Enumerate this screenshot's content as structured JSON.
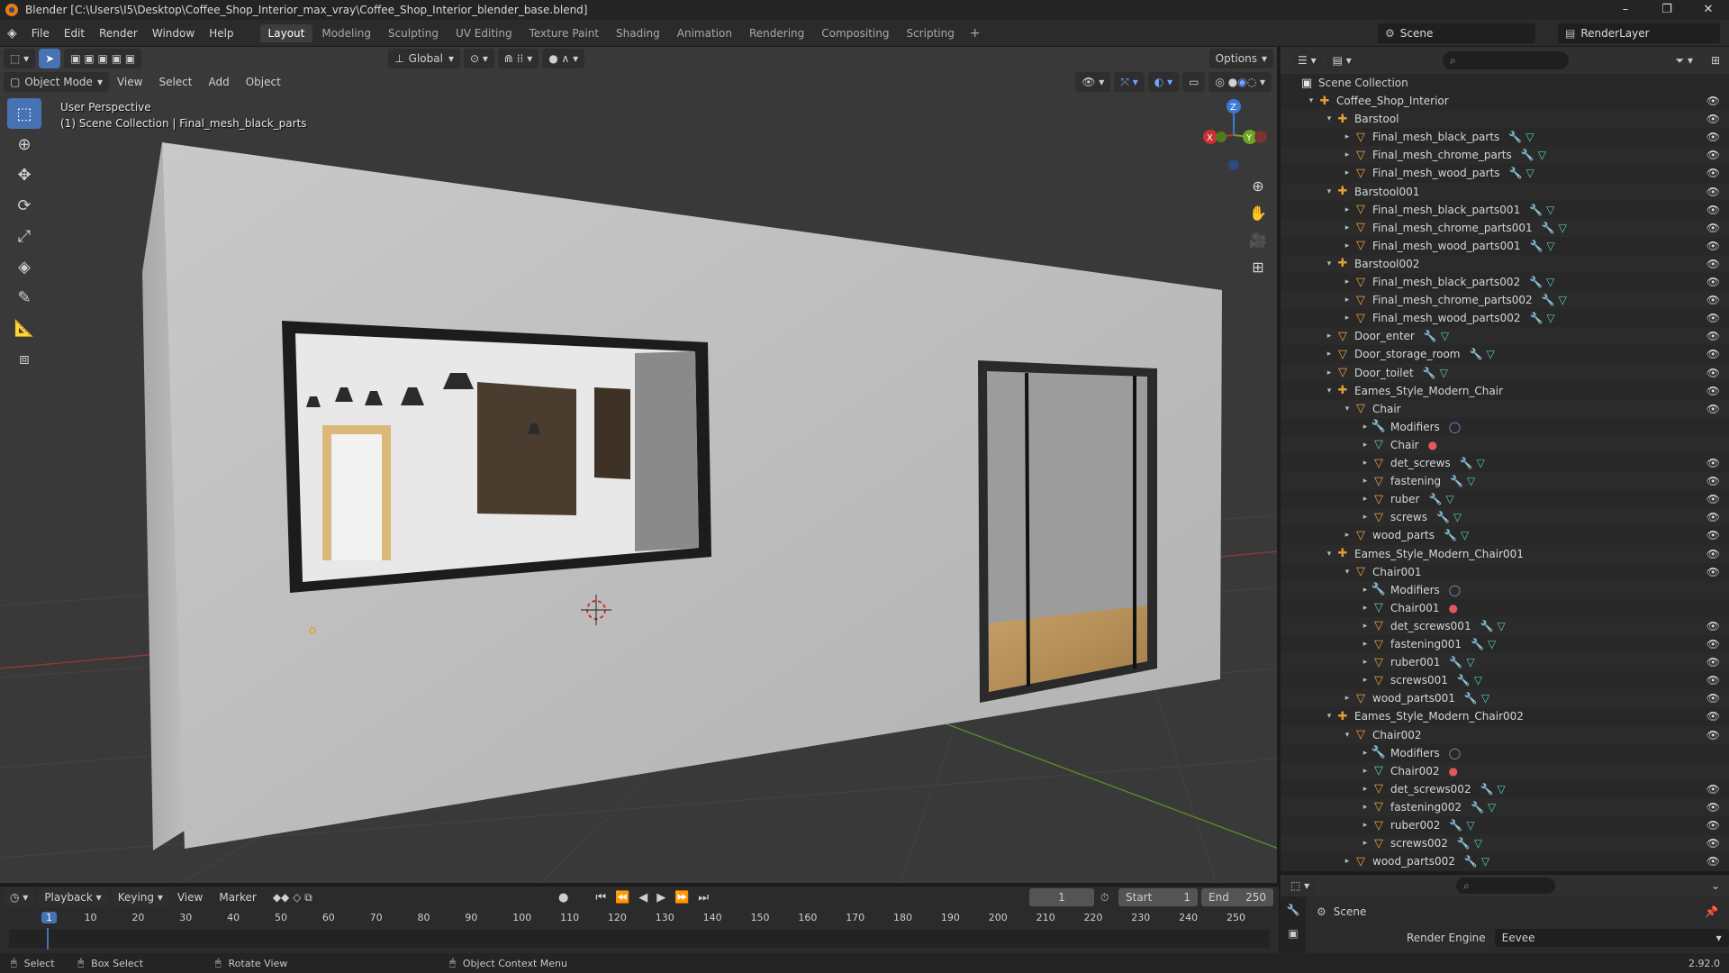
{
  "window": {
    "title": "Blender [C:\\Users\\I5\\Desktop\\Coffee_Shop_Interior_max_vray\\Coffee_Shop_Interior_blender_base.blend]",
    "controls": [
      "–",
      "❐",
      "✕"
    ]
  },
  "menubar": {
    "menus": [
      "File",
      "Edit",
      "Render",
      "Window",
      "Help"
    ],
    "workspaces": [
      "Layout",
      "Modeling",
      "Sculpting",
      "UV Editing",
      "Texture Paint",
      "Shading",
      "Animation",
      "Rendering",
      "Compositing",
      "Scripting"
    ],
    "active_workspace": "Layout",
    "scene": "Scene",
    "view_layer": "RenderLayer"
  },
  "viewport": {
    "mode": "Object Mode",
    "menus": [
      "View",
      "Select",
      "Add",
      "Object"
    ],
    "transform_orientation": "Global",
    "options_label": "Options",
    "info_line1": "User Perspective",
    "info_line2": "(1) Scene Collection | Final_mesh_black_parts",
    "gizmo": {
      "z": "Z",
      "y": "Y",
      "x": "X"
    }
  },
  "outliner": {
    "root": "Scene Collection",
    "rows": [
      {
        "indent": 1,
        "arrow": "▾",
        "icon": "empty",
        "label": "Coffee_Shop_Interior",
        "tags": [],
        "eye": true
      },
      {
        "indent": 2,
        "arrow": "▾",
        "icon": "empty",
        "label": "Barstool",
        "tags": [],
        "eye": true
      },
      {
        "indent": 3,
        "arrow": "▸",
        "icon": "mesh",
        "label": "Final_mesh_black_parts",
        "tags": [
          "w",
          "t"
        ],
        "eye": true
      },
      {
        "indent": 3,
        "arrow": "▸",
        "icon": "mesh",
        "label": "Final_mesh_chrome_parts",
        "tags": [
          "w",
          "t"
        ],
        "eye": true
      },
      {
        "indent": 3,
        "arrow": "▸",
        "icon": "mesh",
        "label": "Final_mesh_wood_parts",
        "tags": [
          "w",
          "t"
        ],
        "eye": true
      },
      {
        "indent": 2,
        "arrow": "▾",
        "icon": "empty",
        "label": "Barstool001",
        "tags": [],
        "eye": true
      },
      {
        "indent": 3,
        "arrow": "▸",
        "icon": "mesh",
        "label": "Final_mesh_black_parts001",
        "tags": [
          "w",
          "t"
        ],
        "eye": true
      },
      {
        "indent": 3,
        "arrow": "▸",
        "icon": "mesh",
        "label": "Final_mesh_chrome_parts001",
        "tags": [
          "w",
          "t"
        ],
        "eye": true
      },
      {
        "indent": 3,
        "arrow": "▸",
        "icon": "mesh",
        "label": "Final_mesh_wood_parts001",
        "tags": [
          "w",
          "t"
        ],
        "eye": true
      },
      {
        "indent": 2,
        "arrow": "▾",
        "icon": "empty",
        "label": "Barstool002",
        "tags": [],
        "eye": true
      },
      {
        "indent": 3,
        "arrow": "▸",
        "icon": "mesh",
        "label": "Final_mesh_black_parts002",
        "tags": [
          "w",
          "t"
        ],
        "eye": true
      },
      {
        "indent": 3,
        "arrow": "▸",
        "icon": "mesh",
        "label": "Final_mesh_chrome_parts002",
        "tags": [
          "w",
          "t"
        ],
        "eye": true
      },
      {
        "indent": 3,
        "arrow": "▸",
        "icon": "mesh",
        "label": "Final_mesh_wood_parts002",
        "tags": [
          "w",
          "t"
        ],
        "eye": true
      },
      {
        "indent": 2,
        "arrow": "▸",
        "icon": "mesh",
        "label": "Door_enter",
        "tags": [
          "w",
          "t"
        ],
        "eye": true
      },
      {
        "indent": 2,
        "arrow": "▸",
        "icon": "mesh",
        "label": "Door_storage_room",
        "tags": [
          "w",
          "t"
        ],
        "eye": true
      },
      {
        "indent": 2,
        "arrow": "▸",
        "icon": "mesh",
        "label": "Door_toilet",
        "tags": [
          "w",
          "t"
        ],
        "eye": true
      },
      {
        "indent": 2,
        "arrow": "▾",
        "icon": "empty",
        "label": "Eames_Style_Modern_Chair",
        "tags": [],
        "eye": true
      },
      {
        "indent": 3,
        "arrow": "▾",
        "icon": "mesh",
        "label": "Chair",
        "tags": [],
        "eye": true
      },
      {
        "indent": 4,
        "arrow": "▸",
        "icon": "mod",
        "label": "Modifiers",
        "tags": [
          "m"
        ],
        "eye": false
      },
      {
        "indent": 4,
        "arrow": "▸",
        "icon": "data",
        "label": "Chair",
        "tags": [
          "r"
        ],
        "eye": false
      },
      {
        "indent": 4,
        "arrow": "▸",
        "icon": "mesh",
        "label": "det_screws",
        "tags": [
          "w",
          "t"
        ],
        "eye": true
      },
      {
        "indent": 4,
        "arrow": "▸",
        "icon": "mesh",
        "label": "fastening",
        "tags": [
          "w",
          "t"
        ],
        "eye": true
      },
      {
        "indent": 4,
        "arrow": "▸",
        "icon": "mesh",
        "label": "ruber",
        "tags": [
          "w",
          "t"
        ],
        "eye": true
      },
      {
        "indent": 4,
        "arrow": "▸",
        "icon": "mesh",
        "label": "screws",
        "tags": [
          "w",
          "t"
        ],
        "eye": true
      },
      {
        "indent": 3,
        "arrow": "▸",
        "icon": "mesh",
        "label": "wood_parts",
        "tags": [
          "w",
          "t"
        ],
        "eye": true
      },
      {
        "indent": 2,
        "arrow": "▾",
        "icon": "empty",
        "label": "Eames_Style_Modern_Chair001",
        "tags": [],
        "eye": true
      },
      {
        "indent": 3,
        "arrow": "▾",
        "icon": "mesh",
        "label": "Chair001",
        "tags": [],
        "eye": true
      },
      {
        "indent": 4,
        "arrow": "▸",
        "icon": "mod",
        "label": "Modifiers",
        "tags": [
          "m"
        ],
        "eye": false
      },
      {
        "indent": 4,
        "arrow": "▸",
        "icon": "data",
        "label": "Chair001",
        "tags": [
          "r"
        ],
        "eye": false
      },
      {
        "indent": 4,
        "arrow": "▸",
        "icon": "mesh",
        "label": "det_screws001",
        "tags": [
          "w",
          "t"
        ],
        "eye": true
      },
      {
        "indent": 4,
        "arrow": "▸",
        "icon": "mesh",
        "label": "fastening001",
        "tags": [
          "w",
          "t"
        ],
        "eye": true
      },
      {
        "indent": 4,
        "arrow": "▸",
        "icon": "mesh",
        "label": "ruber001",
        "tags": [
          "w",
          "t"
        ],
        "eye": true
      },
      {
        "indent": 4,
        "arrow": "▸",
        "icon": "mesh",
        "label": "screws001",
        "tags": [
          "w",
          "t"
        ],
        "eye": true
      },
      {
        "indent": 3,
        "arrow": "▸",
        "icon": "mesh",
        "label": "wood_parts001",
        "tags": [
          "w",
          "t"
        ],
        "eye": true
      },
      {
        "indent": 2,
        "arrow": "▾",
        "icon": "empty",
        "label": "Eames_Style_Modern_Chair002",
        "tags": [],
        "eye": true
      },
      {
        "indent": 3,
        "arrow": "▾",
        "icon": "mesh",
        "label": "Chair002",
        "tags": [],
        "eye": true
      },
      {
        "indent": 4,
        "arrow": "▸",
        "icon": "mod",
        "label": "Modifiers",
        "tags": [
          "m"
        ],
        "eye": false
      },
      {
        "indent": 4,
        "arrow": "▸",
        "icon": "data",
        "label": "Chair002",
        "tags": [
          "r"
        ],
        "eye": false
      },
      {
        "indent": 4,
        "arrow": "▸",
        "icon": "mesh",
        "label": "det_screws002",
        "tags": [
          "w",
          "t"
        ],
        "eye": true
      },
      {
        "indent": 4,
        "arrow": "▸",
        "icon": "mesh",
        "label": "fastening002",
        "tags": [
          "w",
          "t"
        ],
        "eye": true
      },
      {
        "indent": 4,
        "arrow": "▸",
        "icon": "mesh",
        "label": "ruber002",
        "tags": [
          "w",
          "t"
        ],
        "eye": true
      },
      {
        "indent": 4,
        "arrow": "▸",
        "icon": "mesh",
        "label": "screws002",
        "tags": [
          "w",
          "t"
        ],
        "eye": true
      },
      {
        "indent": 3,
        "arrow": "▸",
        "icon": "mesh",
        "label": "wood_parts002",
        "tags": [
          "w",
          "t"
        ],
        "eye": true
      }
    ]
  },
  "properties": {
    "scene_label": "Scene",
    "render_engine_label": "Render Engine",
    "render_engine_value": "Eevee"
  },
  "timeline": {
    "menus": [
      "Playback",
      "Keying",
      "View",
      "Marker"
    ],
    "current_frame": "1",
    "start_label": "Start",
    "start_value": "1",
    "end_label": "End",
    "end_value": "250",
    "ticks": [
      "1",
      "10",
      "20",
      "30",
      "40",
      "50",
      "60",
      "70",
      "80",
      "90",
      "100",
      "110",
      "120",
      "130",
      "140",
      "150",
      "160",
      "170",
      "180",
      "190",
      "200",
      "210",
      "220",
      "230",
      "240",
      "250"
    ]
  },
  "statusbar": {
    "select": "Select",
    "box_select": "Box Select",
    "rotate_view": "Rotate View",
    "context_menu": "Object Context Menu",
    "version": "2.92.0"
  }
}
